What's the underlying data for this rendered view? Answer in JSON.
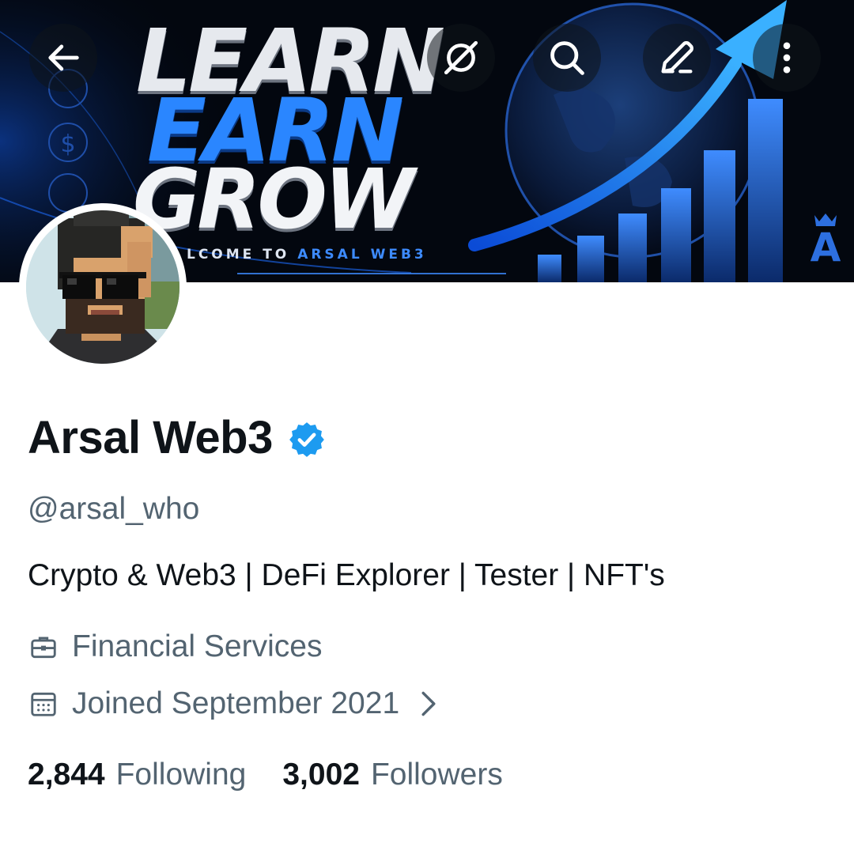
{
  "banner": {
    "line1": "LEARN",
    "line2": "EARN",
    "line3": "GROW",
    "tagline_prefix": "LCOME TO",
    "tagline_highlight": "ARSAL WEB3",
    "colors": {
      "background": "#03070f",
      "accent": "#2a86ff"
    }
  },
  "nav": {
    "back_icon": "arrow-left-icon",
    "grok_icon": "grok-icon",
    "search_icon": "search-icon",
    "compose_icon": "pencil-icon",
    "more_icon": "more-vertical-icon"
  },
  "profile": {
    "name": "Arsal Web3",
    "verified": true,
    "handle": "@arsal_who",
    "bio": "Crypto & Web3 | DeFi Explorer | Tester | NFT's",
    "category": "Financial Services",
    "joined": "Joined September 2021",
    "following_count": "2,844",
    "following_label": "Following",
    "followers_count": "3,002",
    "followers_label": "Followers"
  },
  "colors": {
    "text_primary": "#0f1419",
    "text_secondary": "#536471",
    "verified_blue": "#1d9bf0",
    "background": "#ffffff"
  }
}
